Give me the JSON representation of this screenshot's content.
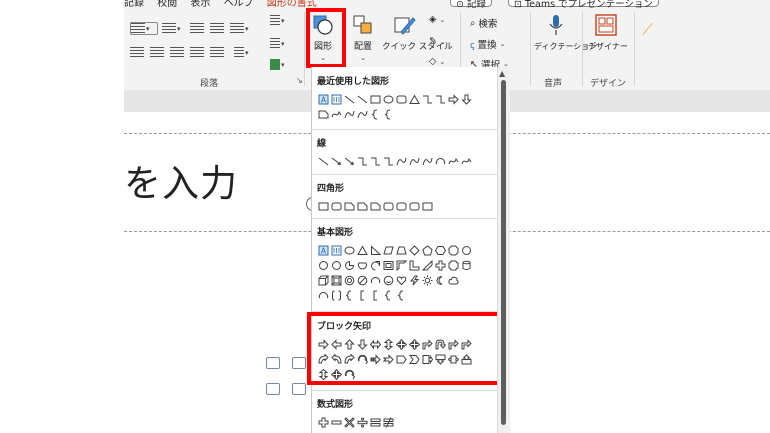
{
  "ribbon": {
    "tabs": [
      "記録",
      "校閲",
      "表示",
      "ヘルプ",
      "図形の書式"
    ],
    "record_button": "記録",
    "teams_button": "Teams でプレゼンテーション",
    "paragraph_group": "段落",
    "drawing": {
      "shapes_label": "図形",
      "arrange_label": "配置",
      "quick_styles_label": "クイック スタイル"
    },
    "editing": {
      "find": "検索",
      "replace": "置換",
      "select": "選択"
    },
    "dictate_label": "ディクテーション",
    "voice_group": "音声",
    "designer_label": "デザイナー",
    "designer_group": "デザイン"
  },
  "slide": {
    "title_text": "を入力"
  },
  "gallery": {
    "recent": "最近使用した図形",
    "lines": "線",
    "rectangles": "四角形",
    "basic": "基本図形",
    "block_arrows": "ブロック矢印",
    "equation": "数式図形"
  },
  "colors": {
    "highlight": "#ff0000",
    "shape_stroke": "#404040",
    "selected_shape_fill": "#cfe3f7"
  }
}
